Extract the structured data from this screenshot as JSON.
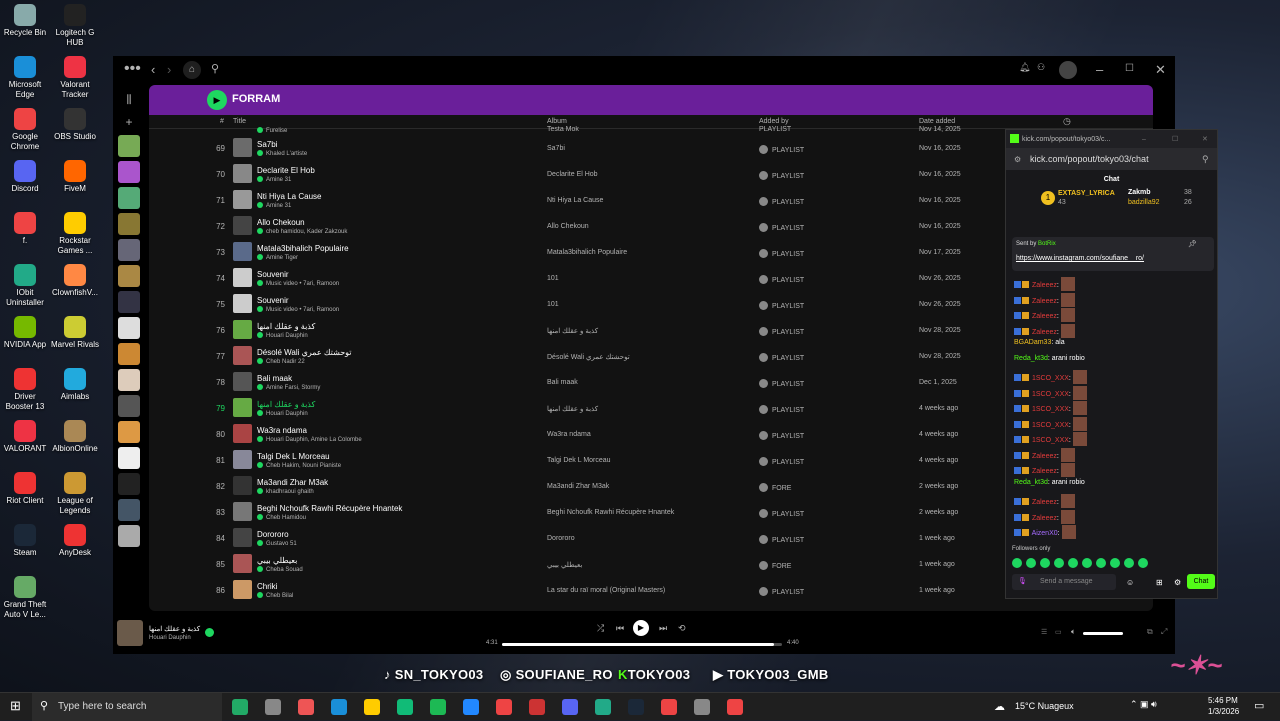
{
  "desktop_icons": [
    {
      "label": "Recycle Bin",
      "color": "#8aa"
    },
    {
      "label": "Logitech G HUB",
      "color": "#222"
    },
    {
      "label": "Microsoft Edge",
      "color": "#1a8fd8"
    },
    {
      "label": "Valorant Tracker",
      "color": "#e34"
    },
    {
      "label": "Google Chrome",
      "color": "#e44"
    },
    {
      "label": "OBS Studio",
      "color": "#333"
    },
    {
      "label": "Discord",
      "color": "#5865f2"
    },
    {
      "label": "FiveM",
      "color": "#f60"
    },
    {
      "label": "f.",
      "color": "#e44"
    },
    {
      "label": "Rockstar Games ...",
      "color": "#fc0"
    },
    {
      "label": "IObit Uninstaller",
      "color": "#2a8"
    },
    {
      "label": "ClownfishV...",
      "color": "#f84"
    },
    {
      "label": "NVIDIA App",
      "color": "#76b900"
    },
    {
      "label": "Marvel Rivals",
      "color": "#cc3"
    },
    {
      "label": "Driver Booster 13",
      "color": "#e33"
    },
    {
      "label": "Aimlabs",
      "color": "#2ad"
    },
    {
      "label": "VALORANT",
      "color": "#e34"
    },
    {
      "label": "AlbionOnline",
      "color": "#a85"
    },
    {
      "label": "Riot Client",
      "color": "#e33"
    },
    {
      "label": "League of Legends",
      "color": "#c93"
    },
    {
      "label": "Steam",
      "color": "#1b2838"
    },
    {
      "label": "AnyDesk",
      "color": "#e33"
    },
    {
      "label": "Grand Theft Auto V Le...",
      "color": "#6a6"
    }
  ],
  "playlist": {
    "title": "FORRAM",
    "columns": {
      "num": "#",
      "title": "Title",
      "album": "Album",
      "added_by": "Added by",
      "date": "Date added"
    },
    "partial_row": {
      "artist": "Furelise",
      "album": "Testa Mok",
      "added": "PLAYLIST",
      "date": "Nov 14, 2025"
    },
    "rows": [
      {
        "n": "69",
        "title": "Sa7bi",
        "artist": "Khaled L'artiste",
        "album": "Sa7bi",
        "added": "PLAYLIST",
        "date": "Nov 16, 2025"
      },
      {
        "n": "70",
        "title": "Declarite El Hob",
        "artist": "Amine 31",
        "album": "Declarite El Hob",
        "added": "PLAYLIST",
        "date": "Nov 16, 2025"
      },
      {
        "n": "71",
        "title": "Nti Hiya La Cause",
        "artist": "Amine 31",
        "album": "Nti Hiya La Cause",
        "added": "PLAYLIST",
        "date": "Nov 16, 2025"
      },
      {
        "n": "72",
        "title": "Allo Chekoun",
        "artist": "cheb hamidou, Kader Zakzouk",
        "album": "Allo Chekoun",
        "added": "PLAYLIST",
        "date": "Nov 16, 2025"
      },
      {
        "n": "73",
        "title": "Matala3bihalich Populaire",
        "artist": "Amine Tiger",
        "album": "Matala3bihalich Populaire",
        "added": "PLAYLIST",
        "date": "Nov 17, 2025"
      },
      {
        "n": "74",
        "title": "Souvenir",
        "artist": "Music video • 7ari, Ramoon",
        "album": "101",
        "added": "PLAYLIST",
        "date": "Nov 26, 2025"
      },
      {
        "n": "75",
        "title": "Souvenir",
        "artist": "Music video • 7ari, Ramoon",
        "album": "101",
        "added": "PLAYLIST",
        "date": "Nov 26, 2025"
      },
      {
        "n": "76",
        "title": "كذبة و عقلك امنها",
        "artist": "Houari Dauphin",
        "album": "كذبة و عقلك امنها",
        "added": "PLAYLIST",
        "date": "Nov 28, 2025"
      },
      {
        "n": "77",
        "title": "Désolé Wali توحشتك عمري",
        "artist": "Cheb Nadir 22",
        "album": "Désolé Wali توحشتك عمري",
        "added": "PLAYLIST",
        "date": "Nov 28, 2025"
      },
      {
        "n": "78",
        "title": "Bali maak",
        "artist": "Amine Farsi, Stormy",
        "album": "Bali maak",
        "added": "PLAYLIST",
        "date": "Dec 1, 2025"
      },
      {
        "n": "79",
        "title": "كذبة و عقلك امنها",
        "artist": "Houari Dauphin",
        "album": "كذبة و عقلك امنها",
        "added": "PLAYLIST",
        "date": "4 weeks ago",
        "active": true
      },
      {
        "n": "80",
        "title": "Wa3ra ndama",
        "artist": "Houari Dauphin, Amine La Colombe",
        "album": "Wa3ra ndama",
        "added": "PLAYLIST",
        "date": "4 weeks ago"
      },
      {
        "n": "81",
        "title": "Talgi Dek L Morceau",
        "artist": "Cheb Hakim, Nouni Pianiste",
        "album": "Talgi Dek L Morceau",
        "added": "PLAYLIST",
        "date": "4 weeks ago"
      },
      {
        "n": "82",
        "title": "Ma3andi Zhar M3ak",
        "artist": "khadhraoui ghaith",
        "album": "Ma3andi Zhar M3ak",
        "added": "FORE",
        "date": "2 weeks ago"
      },
      {
        "n": "83",
        "title": "Beghi Nchoufk Rawhi Récupère Hnantek",
        "artist": "Cheb Hamidou",
        "album": "Beghi Nchoufk Rawhi Récupère Hnantek",
        "added": "PLAYLIST",
        "date": "2 weeks ago"
      },
      {
        "n": "84",
        "title": "Dorororo",
        "artist": "Gustavo 51",
        "album": "Dorororo",
        "added": "PLAYLIST",
        "date": "1 week ago"
      },
      {
        "n": "85",
        "title": "بعيطلي بيبي",
        "artist": "Cheba Souad",
        "album": "بعيطلي بيبي",
        "added": "FORE",
        "date": "1 week ago"
      },
      {
        "n": "86",
        "title": "Chriki",
        "artist": "Cheb Bilal",
        "album": "La star du raï moral (Original Masters)",
        "added": "PLAYLIST",
        "date": "1 week ago"
      }
    ]
  },
  "player": {
    "track": "كذبة و عقلك امنها",
    "artist": "Houari Dauphin",
    "elapsed": "4:31",
    "total": "4:40",
    "progress": 0.97
  },
  "chat": {
    "window_title": "kick.com/popout/tokyo03/c...",
    "url": "kick.com/popout/tokyo03/chat",
    "tab": "Chat",
    "top": {
      "rank": "1",
      "name": "EXTASY_LYRICA",
      "count": "43",
      "u2": "Zakmb",
      "c2": "38",
      "u3": "badzilla92",
      "c3": "26"
    },
    "pinned_by": "Sent by",
    "pinned_user": "BotRix",
    "pinned_link": "https://www.instagram.com/soufiane__ro/",
    "messages": [
      {
        "user": "Zaleeez",
        "cls": "red",
        "text": ":"
      },
      {
        "user": "Zaleeez",
        "cls": "red",
        "text": ":"
      },
      {
        "user": "Zaleeez",
        "cls": "red",
        "text": ":"
      },
      {
        "user": "Zaleeez",
        "cls": "red",
        "text": ":"
      },
      {
        "user": "BGADam33",
        "cls": "yel",
        "text": ": ala"
      },
      {
        "user": "Reda_kt3d",
        "cls": "grn",
        "text": ": arani robio"
      },
      {
        "user": "1SCO_XXX",
        "cls": "red",
        "text": ":"
      },
      {
        "user": "1SCO_XXX",
        "cls": "red",
        "text": ":"
      },
      {
        "user": "1SCO_XXX",
        "cls": "red",
        "text": ":"
      },
      {
        "user": "1SCO_XXX",
        "cls": "red",
        "text": ":"
      },
      {
        "user": "1SCO_XXX",
        "cls": "red",
        "text": ":"
      },
      {
        "user": "Zaleeez",
        "cls": "red",
        "text": ":"
      },
      {
        "user": "Zaleeez",
        "cls": "red",
        "text": ":"
      },
      {
        "user": "Reda_kt3d",
        "cls": "grn",
        "text": ": arani robio"
      },
      {
        "user": "Zaleeez",
        "cls": "red",
        "text": ":"
      },
      {
        "user": "Zaleeez",
        "cls": "red",
        "text": ":"
      },
      {
        "user": "AizenX0",
        "cls": "pur",
        "text": ":"
      }
    ],
    "followers_only": "Followers only",
    "input_placeholder": "Send a message",
    "send": "Chat"
  },
  "overlay": {
    "s1": "SN_TOKYO03",
    "s2": "SOUFIANE_RO",
    "s3": "TOKYO03",
    "s4": "TOKYO03_GMB"
  },
  "taskbar": {
    "search": "Type here to search",
    "weather": "15°C  Nuageux",
    "time": "5:46 PM",
    "date": "1/3/2026"
  }
}
